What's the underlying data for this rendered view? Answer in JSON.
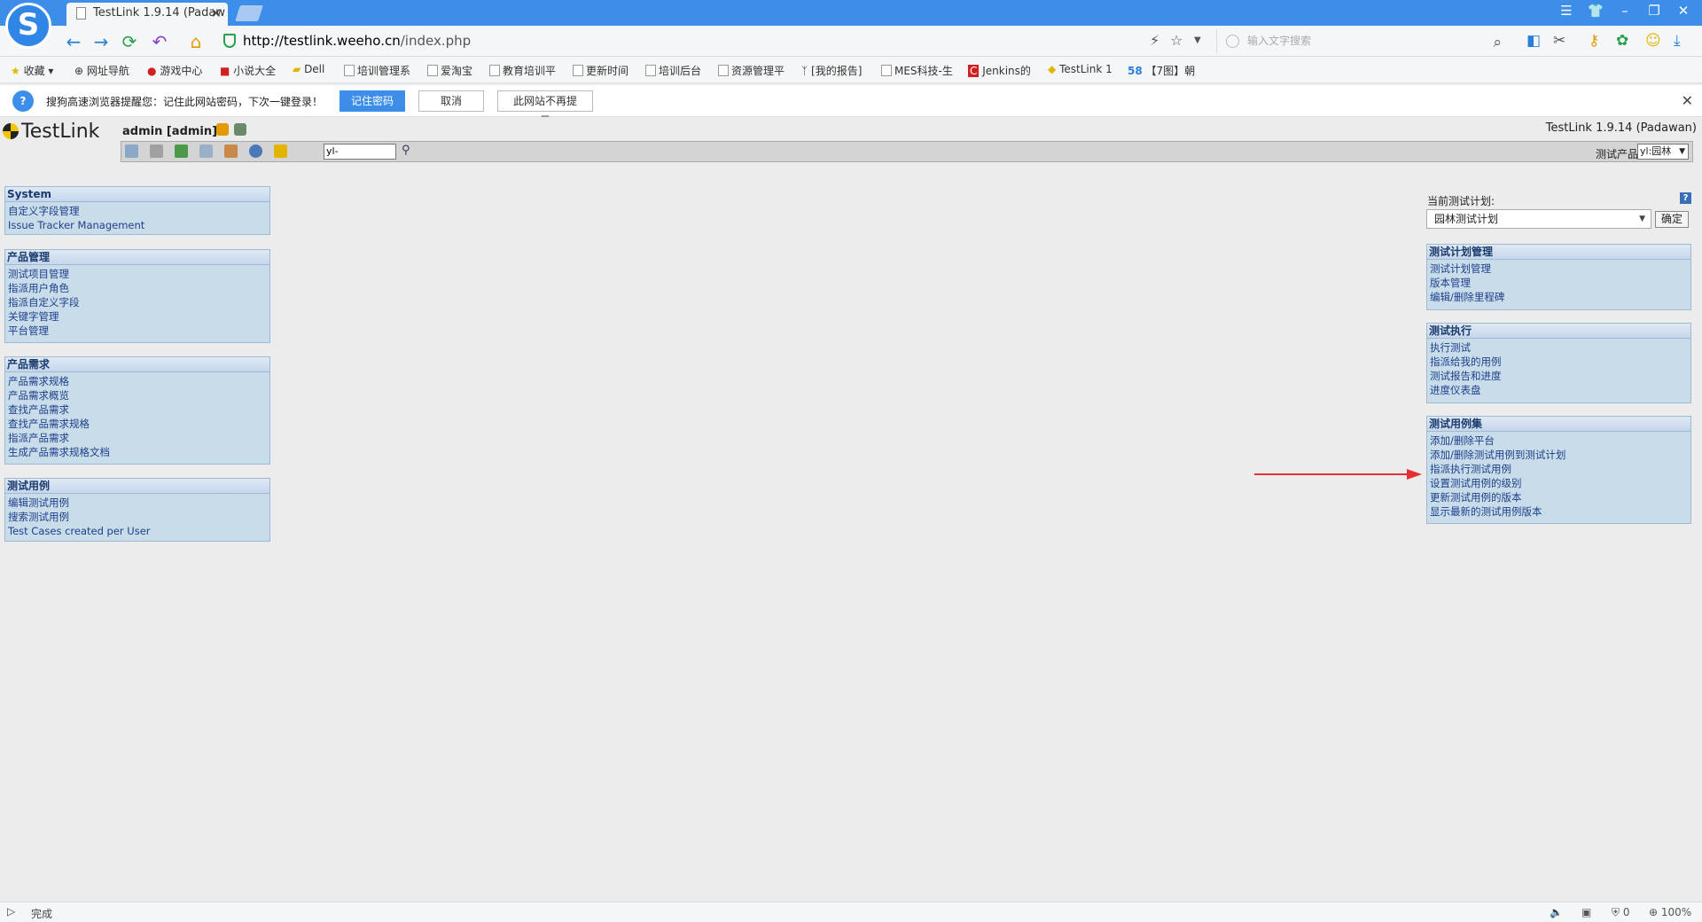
{
  "browser": {
    "tab_title": "TestLink 1.9.14 (Padaw",
    "url_host": "http://testlink.weeho.cn",
    "url_path": "/index.php",
    "search_placeholder": "输入文字搜索"
  },
  "bookmarks": [
    "收藏",
    "网址导航",
    "游戏中心",
    "小说大全",
    "Dell",
    "培训管理系",
    "爱淘宝",
    "教育培训平",
    "更新时间",
    "培训后台",
    "资源管理平",
    "[我的报告]",
    "MES科技-生",
    "Jenkins的",
    "TestLink 1",
    "【7图】朝"
  ],
  "password_prompt": {
    "message": "搜狗高速浏览器提醒您：记住此网站密码，下次一键登录！",
    "remember": "记住密码",
    "cancel": "取消",
    "never": "此网站不再提示"
  },
  "testlink": {
    "logo_text": "TestLink",
    "user": "admin [admin]",
    "version": "TestLink 1.9.14 (Padawan)",
    "search_value": "yl-",
    "product_label": "测试产品",
    "product_value": "yl:园林"
  },
  "left_blocks": [
    {
      "title": "System",
      "links": [
        "自定义字段管理",
        "Issue Tracker Management"
      ]
    },
    {
      "title": "产品管理",
      "links": [
        "测试项目管理",
        "指派用户角色",
        "指派自定义字段",
        "关键字管理",
        "平台管理"
      ]
    },
    {
      "title": "产品需求",
      "links": [
        "产品需求规格",
        "产品需求概览",
        "查找产品需求",
        "查找产品需求规格",
        "指派产品需求",
        "生成产品需求规格文档"
      ]
    },
    {
      "title": "测试用例",
      "links": [
        "编辑测试用例",
        "搜索测试用例",
        "Test Cases created per User"
      ]
    }
  ],
  "plan": {
    "label": "当前测试计划:",
    "selected": "园林测试计划",
    "ok": "确定",
    "help": "?"
  },
  "right_blocks": [
    {
      "title": "测试计划管理",
      "links": [
        "测试计划管理",
        "版本管理",
        "编辑/删除里程碑"
      ]
    },
    {
      "title": "测试执行",
      "links": [
        "执行测试",
        "指派给我的用例",
        "测试报告和进度",
        "进度仪表盘"
      ]
    },
    {
      "title": "测试用例集",
      "links": [
        "添加/删除平台",
        "添加/删除测试用例到测试计划",
        "指派执行测试用例",
        "设置测试用例的级别",
        "更新测试用例的版本",
        "显示最新的测试用例版本"
      ]
    }
  ],
  "statusbar": {
    "status": "完成",
    "count": "0",
    "zoom": "100%"
  }
}
